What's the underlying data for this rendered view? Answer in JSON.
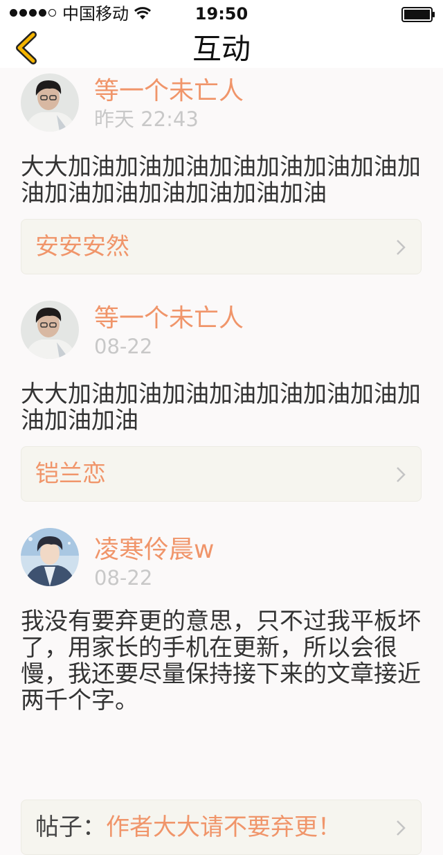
{
  "status_bar": {
    "carrier": "中国移动",
    "time": "19:50"
  },
  "nav": {
    "title": "互动",
    "back_icon": "chevron-left-icon",
    "accent_color": "#f4b400"
  },
  "items": [
    {
      "username": "等一个未亡人",
      "time": "昨天 22:43",
      "content": "大大加油加油加油加油加油加油加油加油加油加油加油加油加油加油",
      "link_prefix": "",
      "link_label": "安安安然"
    },
    {
      "username": "等一个未亡人",
      "time": "08-22",
      "content": "大大加油加油加油加油加油加油加油加油加油加油",
      "link_prefix": "",
      "link_label": "铠兰恋"
    },
    {
      "username": "凌寒伶晨w",
      "time": "08-22",
      "content": "我没有要弃更的意思，只不过我平板坏了，用家长的手机在更新，所以会很慢，我还要尽量保持接下来的文章接近两千个字。",
      "link_prefix": "帖子：",
      "link_label": "作者大大请不要弃更！"
    }
  ],
  "colors": {
    "username": "#f0956a",
    "timestamp": "#c8c8c8",
    "link_box_bg": "#f6f5ef",
    "page_bg": "#fbf9f9"
  }
}
